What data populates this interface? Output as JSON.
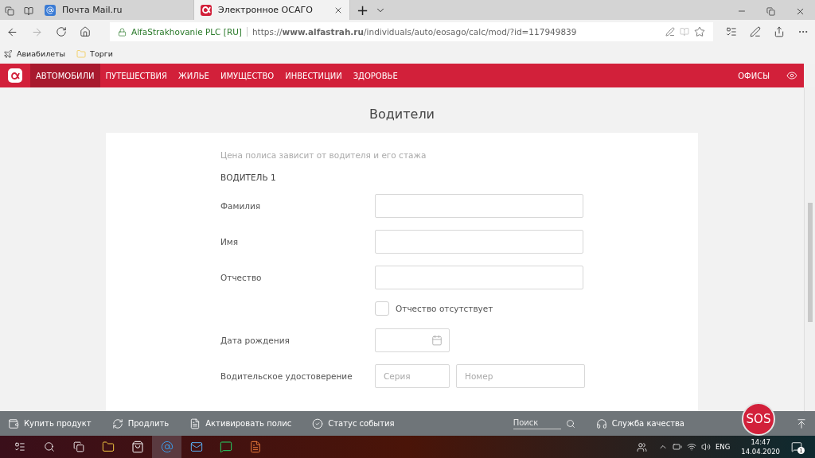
{
  "browser": {
    "tabs": [
      {
        "title": "Почта Mail.ru",
        "selected": false,
        "kind": "mail"
      },
      {
        "title": "Электронное ОСАГО",
        "selected": true,
        "kind": "alfa"
      }
    ],
    "new_tab": "+",
    "site_identity": "AlfaStrakhovanie PLC [RU]",
    "url": "https://**www.alfastrah.ru**/individuals/auto/eosago/calc/mod/?id=117949839",
    "bookmarks": [
      {
        "label": "Авиабилеты",
        "kind": "plane"
      },
      {
        "label": "Торги",
        "kind": "folder"
      }
    ]
  },
  "site_nav": {
    "items": [
      {
        "label": "АВТОМОБИЛИ",
        "selected": true
      },
      {
        "label": "ПУТЕШЕСТВИЯ",
        "selected": false
      },
      {
        "label": "ЖИЛЬЕ",
        "selected": false
      },
      {
        "label": "ИМУЩЕСТВО",
        "selected": false
      },
      {
        "label": "ИНВЕСТИЦИИ",
        "selected": false
      },
      {
        "label": "ЗДОРОВЬЕ",
        "selected": false
      }
    ],
    "offices": "ОФИСЫ"
  },
  "page": {
    "title": "Водители",
    "note": "Цена полиса зависит от водителя и его стажа",
    "section": "ВОДИТЕЛЬ 1",
    "fields": [
      {
        "kind": "text",
        "label": "Фамилия"
      },
      {
        "kind": "text",
        "label": "Имя"
      },
      {
        "kind": "text",
        "label": "Отчество"
      },
      {
        "kind": "checkbox",
        "label": "Отчество отсутствует",
        "checked": false
      },
      {
        "kind": "date",
        "label": "Дата рождения"
      },
      {
        "kind": "license",
        "label": "Водительское удостоверение",
        "placeholders": [
          "Серия",
          "Номер"
        ]
      }
    ]
  },
  "bottom_bar": {
    "actions": [
      {
        "label": "Купить продукт",
        "kind": "wallet"
      },
      {
        "label": "Продлить",
        "kind": "renew"
      },
      {
        "label": "Активировать полис",
        "kind": "doc"
      },
      {
        "label": "Статус события",
        "kind": "check"
      }
    ],
    "search": {
      "placeholder": "Поиск"
    },
    "quality": "Служба качества",
    "sos": "SOS"
  },
  "taskbar": {
    "language": "ENG",
    "time": "14:47",
    "date": "14.04.2020",
    "notifications": "1"
  }
}
